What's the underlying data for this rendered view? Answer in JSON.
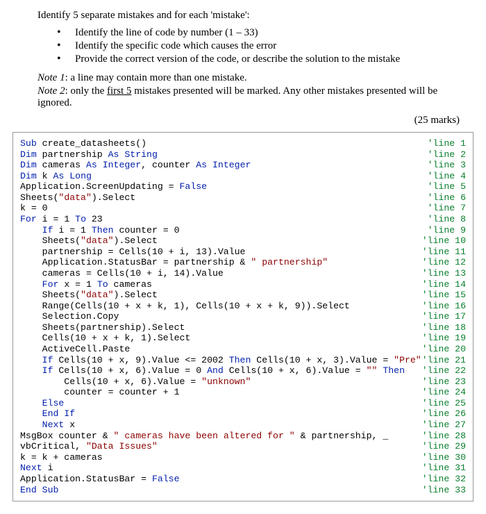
{
  "intro": "Identify 5 separate mistakes and for each 'mistake':",
  "bullets": [
    "Identify the line of code by number (1 – 33)",
    "Identify the specific code which causes the error",
    "Provide the correct version of the code, or describe the solution to the mistake"
  ],
  "note1_label": "Note 1",
  "note1_text": ": a line may contain more than one mistake.",
  "note2_label": "Note 2",
  "note2_text_a": ": only the ",
  "note2_text_u": "first 5",
  "note2_text_b": " mistakes presented will be marked. Any other mistakes presented will be ignored.",
  "marks": "(25 marks)",
  "code": [
    {
      "line": 1,
      "tokens": [
        {
          "t": "Sub",
          "c": "kw"
        },
        {
          "t": " create_datasheets()"
        }
      ]
    },
    {
      "line": 2,
      "tokens": [
        {
          "t": "Dim",
          "c": "kw"
        },
        {
          "t": " partnership "
        },
        {
          "t": "As String",
          "c": "ty"
        }
      ]
    },
    {
      "line": 3,
      "tokens": [
        {
          "t": "Dim",
          "c": "kw"
        },
        {
          "t": " cameras "
        },
        {
          "t": "As Integer",
          "c": "ty"
        },
        {
          "t": ", counter "
        },
        {
          "t": "As Integer",
          "c": "ty"
        }
      ]
    },
    {
      "line": 4,
      "tokens": [
        {
          "t": "Dim",
          "c": "kw"
        },
        {
          "t": " k "
        },
        {
          "t": "As Long",
          "c": "ty"
        }
      ]
    },
    {
      "line": 5,
      "tokens": [
        {
          "t": "Application.ScreenUpdating = "
        },
        {
          "t": "False",
          "c": "kw"
        }
      ]
    },
    {
      "line": 6,
      "tokens": [
        {
          "t": "Sheets("
        },
        {
          "t": "\"data\"",
          "c": "str"
        },
        {
          "t": ").Select"
        }
      ]
    },
    {
      "line": 7,
      "tokens": [
        {
          "t": "k = 0"
        }
      ]
    },
    {
      "line": 8,
      "tokens": [
        {
          "t": "For",
          "c": "kw"
        },
        {
          "t": " i = 1 "
        },
        {
          "t": "To",
          "c": "kw"
        },
        {
          "t": " 23"
        }
      ]
    },
    {
      "line": 9,
      "tokens": [
        {
          "t": "    "
        },
        {
          "t": "If",
          "c": "kw"
        },
        {
          "t": " i = 1 "
        },
        {
          "t": "Then",
          "c": "kw"
        },
        {
          "t": " counter = 0"
        }
      ]
    },
    {
      "line": 10,
      "tokens": [
        {
          "t": "    Sheets("
        },
        {
          "t": "\"data\"",
          "c": "str"
        },
        {
          "t": ").Select"
        }
      ]
    },
    {
      "line": 11,
      "tokens": [
        {
          "t": "    partnership = Cells(10 + i, 13).Value"
        }
      ]
    },
    {
      "line": 12,
      "tokens": [
        {
          "t": "    Application.StatusBar = partnership & "
        },
        {
          "t": "\" partnership\"",
          "c": "str"
        }
      ]
    },
    {
      "line": 13,
      "tokens": [
        {
          "t": "    cameras = Cells(10 + i, 14).Value"
        }
      ]
    },
    {
      "line": 14,
      "tokens": [
        {
          "t": "    "
        },
        {
          "t": "For",
          "c": "kw"
        },
        {
          "t": " x = 1 "
        },
        {
          "t": "To",
          "c": "kw"
        },
        {
          "t": " cameras"
        }
      ]
    },
    {
      "line": 15,
      "tokens": [
        {
          "t": "    Sheets("
        },
        {
          "t": "\"data\"",
          "c": "str"
        },
        {
          "t": ").Select"
        }
      ]
    },
    {
      "line": 16,
      "tokens": [
        {
          "t": "    Range(Cells(10 + x + k, 1), Cells(10 + x + k, 9)).Select"
        }
      ]
    },
    {
      "line": 17,
      "tokens": [
        {
          "t": "    Selection.Copy"
        }
      ]
    },
    {
      "line": 18,
      "tokens": [
        {
          "t": "    Sheets(partnership).Select"
        }
      ]
    },
    {
      "line": 19,
      "tokens": [
        {
          "t": "    Cells(10 + x + k, 1).Select"
        }
      ]
    },
    {
      "line": 20,
      "tokens": [
        {
          "t": "    ActiveCell.Paste"
        }
      ]
    },
    {
      "line": 21,
      "tokens": [
        {
          "t": "    "
        },
        {
          "t": "If",
          "c": "kw"
        },
        {
          "t": " Cells(10 + x, 9).Value <= 2002 "
        },
        {
          "t": "Then",
          "c": "kw"
        },
        {
          "t": " Cells(10 + x, 3).Value = "
        },
        {
          "t": "\"Pre\"",
          "c": "str"
        }
      ]
    },
    {
      "line": 22,
      "tokens": [
        {
          "t": "    "
        },
        {
          "t": "If",
          "c": "kw"
        },
        {
          "t": " Cells(10 + x, 6).Value = 0 "
        },
        {
          "t": "And",
          "c": "kw"
        },
        {
          "t": " Cells(10 + x, 6).Value = "
        },
        {
          "t": "\"\"",
          "c": "str"
        },
        {
          "t": " "
        },
        {
          "t": "Then",
          "c": "kw"
        }
      ]
    },
    {
      "line": 23,
      "tokens": [
        {
          "t": "        Cells(10 + x, 6).Value = "
        },
        {
          "t": "\"unknown\"",
          "c": "str"
        }
      ]
    },
    {
      "line": 24,
      "tokens": [
        {
          "t": "        counter = counter + 1"
        }
      ]
    },
    {
      "line": 25,
      "tokens": [
        {
          "t": "    "
        },
        {
          "t": "Else",
          "c": "kw"
        }
      ]
    },
    {
      "line": 26,
      "tokens": [
        {
          "t": "    "
        },
        {
          "t": "End If",
          "c": "kw"
        }
      ]
    },
    {
      "line": 27,
      "tokens": [
        {
          "t": "    "
        },
        {
          "t": "Next",
          "c": "kw"
        },
        {
          "t": " x"
        }
      ]
    },
    {
      "line": 28,
      "tokens": [
        {
          "t": "MsgBox counter & "
        },
        {
          "t": "\" cameras have been altered for \"",
          "c": "str"
        },
        {
          "t": " & partnership, _"
        }
      ]
    },
    {
      "line": 29,
      "tokens": [
        {
          "t": "vbCritical, "
        },
        {
          "t": "\"Data Issues\"",
          "c": "str"
        }
      ]
    },
    {
      "line": 30,
      "tokens": [
        {
          "t": "k = k + cameras"
        }
      ]
    },
    {
      "line": 31,
      "tokens": [
        {
          "t": "Next",
          "c": "kw"
        },
        {
          "t": " i"
        }
      ]
    },
    {
      "line": 32,
      "tokens": [
        {
          "t": "Application.StatusBar = "
        },
        {
          "t": "False",
          "c": "kw"
        }
      ]
    },
    {
      "line": 33,
      "tokens": [
        {
          "t": "End Sub",
          "c": "kw"
        }
      ]
    }
  ]
}
